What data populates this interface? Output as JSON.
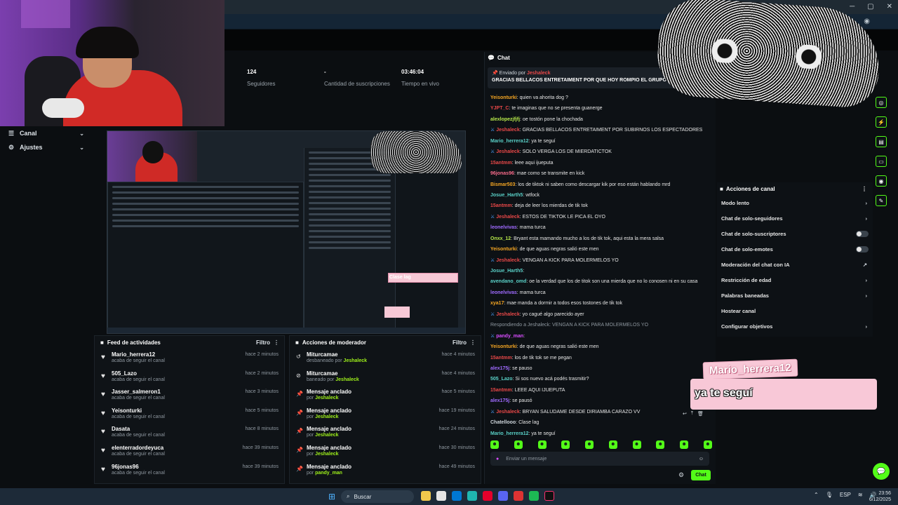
{
  "nav": {
    "canal": "Canal",
    "ajustes": "Ajustes"
  },
  "stats": [
    {
      "value": "124",
      "label": "Seguidores"
    },
    {
      "value": "-",
      "label": "Cantidad de suscripciones"
    },
    {
      "value": "03:46:04",
      "label": "Tiempo en vivo"
    }
  ],
  "preview": {
    "sticker": "Clase lag"
  },
  "activity": {
    "title": "Feed de actividades",
    "filter": "Filtro",
    "items": [
      {
        "name": "Mario_herrera12",
        "sub": "acaba de seguir el canal",
        "time": "hace 2 minutos"
      },
      {
        "name": "505_Lazo",
        "sub": "acaba de seguir el canal",
        "time": "hace 2 minutos"
      },
      {
        "name": "Jasser_salmeron1",
        "sub": "acaba de seguir el canal",
        "time": "hace 3 minutos"
      },
      {
        "name": "Yeisonturki",
        "sub": "acaba de seguir el canal",
        "time": "hace 5 minutos"
      },
      {
        "name": "Dasata",
        "sub": "acaba de seguir el canal",
        "time": "hace 8 minutos"
      },
      {
        "name": "elenterradordeyuca",
        "sub": "acaba de seguir el canal",
        "time": "hace 39 minutos"
      },
      {
        "name": "96jonas96",
        "sub": "acaba de seguir el canal",
        "time": "hace 39 minutos"
      }
    ]
  },
  "modactions": {
    "title": "Acciones de moderador",
    "filter": "Filtro",
    "items": [
      {
        "name": "Miturcamae",
        "pre": "desbaneado por ",
        "by": "Jeshaleck",
        "time": "hace 4 minutos",
        "icon": "↺"
      },
      {
        "name": "Miturcamae",
        "pre": "baneado por ",
        "by": "Jeshaleck",
        "time": "hace 4 minutos",
        "icon": "⊘"
      },
      {
        "name": "Mensaje anclado",
        "pre": "por ",
        "by": "Jeshaleck",
        "time": "hace 5 minutos",
        "icon": "📌"
      },
      {
        "name": "Mensaje anclado",
        "pre": "por ",
        "by": "Jeshaleck",
        "time": "hace 19 minutos",
        "icon": "📌"
      },
      {
        "name": "Mensaje anclado",
        "pre": "por ",
        "by": "Jeshaleck",
        "time": "hace 24 minutos",
        "icon": "📌"
      },
      {
        "name": "Mensaje anclado",
        "pre": "por ",
        "by": "Jeshaleck",
        "time": "hace 30 minutos",
        "icon": "📌"
      },
      {
        "name": "Mensaje anclado",
        "pre": "por ",
        "by": "pandy_man",
        "time": "hace 49 minutos",
        "icon": "📌"
      }
    ]
  },
  "chat": {
    "title": "Chat",
    "pinned_by_label": "Enviado por",
    "pinned_by": "Jeshaleck",
    "pinned_msg": "GRACIAS BELLACOS ENTRETAIMENT POR QUE HOY ROMPIO EL GRUPO DE",
    "input_placeholder": "Enviar un mensaje",
    "send": "Chat",
    "messages": [
      {
        "user": "Yeisonturki",
        "color": "#f5a623",
        "text": "quien va ahorita dog ?"
      },
      {
        "user": "YJPT_C",
        "color": "#e94848",
        "text": "te imaginas que no se presenta guanerge"
      },
      {
        "user": "alexlopezjfjfj",
        "color": "#b6e84a",
        "text": "oe tostón pone la chochada"
      },
      {
        "user": "Jeshaleck",
        "color": "#e94848",
        "text": "GRACIAS BELLACOS ENTRETAIMENT POR SUBIRNOS LOS ESPECTADORES",
        "mod": true
      },
      {
        "user": "Mario_herrera12",
        "color": "#5ad1c8",
        "text": "ya te seguí"
      },
      {
        "user": "Jeshaleck",
        "color": "#e94848",
        "text": "SOLO VERGA LOS DE MIERDATICTOK",
        "mod": true
      },
      {
        "user": "15antmm",
        "color": "#e94848",
        "text": "leee aqui ijueputa"
      },
      {
        "user": "96jonas96",
        "color": "#f76b8a",
        "text": "mae como se transmite en kick"
      },
      {
        "user": "Bismar503",
        "color": "#f5a623",
        "text": "los de tiktok ni saben como descargar kik por eso están hablando mrd"
      },
      {
        "user": "Josue_Harth5",
        "color": "#5ad1c8",
        "text": "wtfock"
      },
      {
        "user": "15antmm",
        "color": "#e94848",
        "text": "deja de leer los mierdas de tik tok"
      },
      {
        "user": "Jeshaleck",
        "color": "#e94848",
        "text": "ESTOS DE TIKTOK LE PICA EL OYO",
        "mod": true
      },
      {
        "user": "leonelvivas",
        "color": "#a06bff",
        "text": "mama turca"
      },
      {
        "user": "Onxx_12",
        "color": "#b6e84a",
        "text": "Bryant esta mamando mucho a los de tik tok, aqui esta la mera salsa"
      },
      {
        "user": "Yeisonturki",
        "color": "#f5a623",
        "text": "de que aguas negras salió este men"
      },
      {
        "user": "Jeshaleck",
        "color": "#e94848",
        "text": "VENGAN A KICK PARA MOLERMELOS YO",
        "mod": true
      },
      {
        "user": "Josue_Harth5",
        "color": "#5ad1c8",
        "text": ""
      },
      {
        "user": "avendano_omd",
        "color": "#5ad1c8",
        "text": "oe la verdad que los de titok son una mierda que no lo conosen ni en su casa"
      },
      {
        "user": "leonelvivas",
        "color": "#a06bff",
        "text": "mama turca"
      },
      {
        "user": "xya17",
        "color": "#f5a623",
        "text": "mae manda a dormir a todos esos tostones de tik tok"
      },
      {
        "user": "Jeshaleck",
        "color": "#e94848",
        "text": "yo cagué algo parecido ayer",
        "mod": true
      },
      {
        "user": "",
        "color": "#8e979f",
        "text": "Respondiendo a Jeshaleck: VENGAN A KICK PARA MOLERMELOS YO",
        "reply": true
      },
      {
        "user": "pandy_man",
        "color": "#d94dff",
        "text": "",
        "mod": true
      },
      {
        "user": "Yeisonturki",
        "color": "#f5a623",
        "text": "de que aguas negras salió este men"
      },
      {
        "user": "15antmm",
        "color": "#e94848",
        "text": "los de tik tok se me pegan"
      },
      {
        "user": "alex175j",
        "color": "#a06bff",
        "text": "se pauso"
      },
      {
        "user": "505_Lazo",
        "color": "#5ad1c8",
        "text": "Si sos nuevo acá podés trasmitir?"
      },
      {
        "user": "15antmm",
        "color": "#e94848",
        "text": "LEEE AQUI IJUEPUTA"
      },
      {
        "user": "alex175j",
        "color": "#a06bff",
        "text": "se pausó"
      },
      {
        "user": "Jeshaleck",
        "color": "#e94848",
        "text": "BRYAN SALUDAME DESDE DIRIAMBA CARAZO VV",
        "mod": true
      },
      {
        "user": "Chatellooo",
        "color": "#cfd6dc",
        "text": "Clase lag"
      },
      {
        "user": "Mario_herrera12",
        "color": "#5ad1c8",
        "text": "ya te seguí"
      }
    ]
  },
  "channel_actions": {
    "title": "Acciones de canal",
    "rows": [
      {
        "label": "Modo lento",
        "kind": "arrow"
      },
      {
        "label": "Chat de solo-seguidores",
        "kind": "arrow"
      },
      {
        "label": "Chat de solo-suscriptores",
        "kind": "toggle"
      },
      {
        "label": "Chat de solo-emotes",
        "kind": "toggle"
      },
      {
        "label": "Moderación del chat con IA",
        "kind": "ext"
      },
      {
        "label": "Restricción de edad",
        "kind": "arrow"
      },
      {
        "label": "Palabras baneadas",
        "kind": "arrow"
      },
      {
        "label": "Hostear canal",
        "kind": "none"
      },
      {
        "label": "Configurar objetivos",
        "kind": "arrow"
      }
    ]
  },
  "overlay": {
    "follow_name": "Mario_herrera12",
    "follow_msg": "ya te seguí"
  },
  "taskbar": {
    "search": "Buscar",
    "lang": "ESP",
    "time": "23:56",
    "date": "6/12/2025"
  },
  "colors": {
    "accent": "#53fc18",
    "background": "#0b0e11"
  }
}
